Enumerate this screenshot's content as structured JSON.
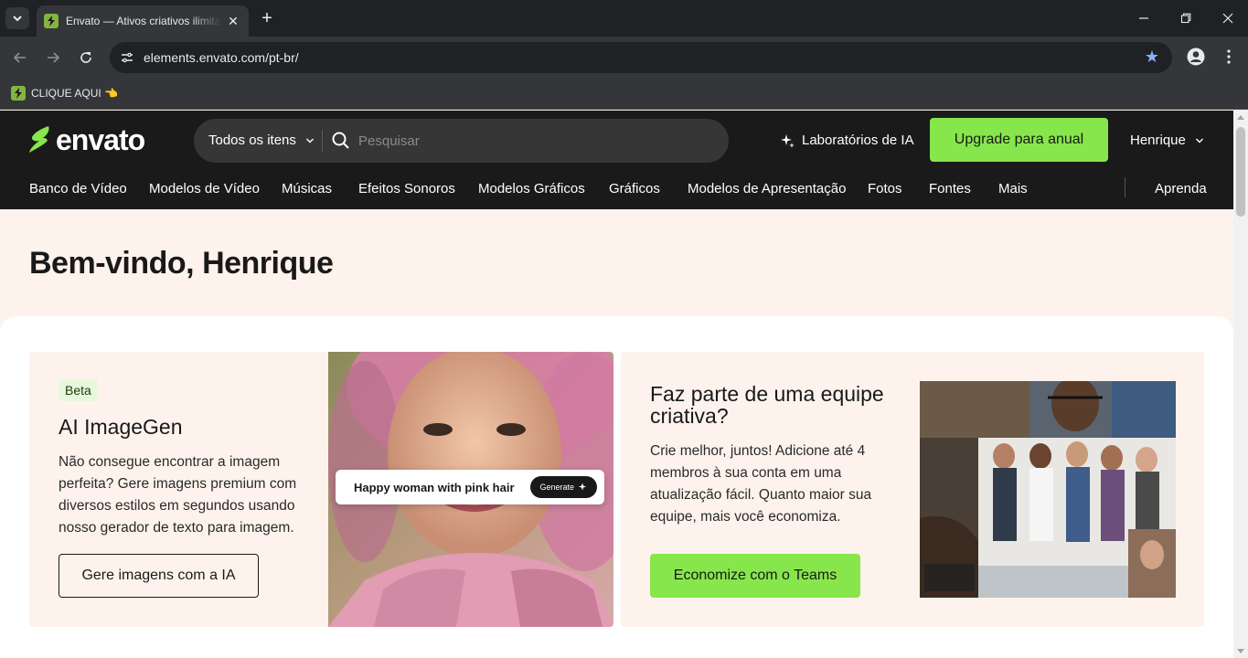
{
  "browser": {
    "tab_title": "Envato — Ativos criativos ilimitados",
    "tab_close": "✕",
    "new_tab": "+",
    "url": "elements.envato.com/pt-br/",
    "bookmark_label": "CLIQUE AQUI 👈"
  },
  "header": {
    "logo_text": "envato",
    "search_category": "Todos os itens",
    "search_placeholder": "Pesquisar",
    "ai_labs": "Laboratórios de IA",
    "upgrade": "Upgrade para anual",
    "user": "Henrique"
  },
  "categories": [
    "Banco de Vídeo",
    "Modelos de Vídeo",
    "Músicas",
    "Efeitos Sonoros",
    "Modelos Gráficos",
    "Gráficos",
    "Modelos de Apresentação",
    "Fotos",
    "Fontes",
    "Mais"
  ],
  "learn": "Aprenda",
  "welcome": "Bem-vindo, Henrique",
  "card_ai": {
    "badge": "Beta",
    "title": "AI ImageGen",
    "description": "Não consegue encontrar a imagem perfeita? Gere imagens premium com diversos estilos em segundos usando nosso gerador de texto para imagem.",
    "button": "Gere imagens com a IA",
    "prompt": "Happy woman with pink hair",
    "generate": "Generate"
  },
  "card_teams": {
    "title": "Faz parte de uma equipe criativa?",
    "description": "Crie melhor, juntos! Adicione até 4 membros à sua conta em uma atualização fácil. Quanto maior sua equipe, mais você economiza.",
    "button": "Economize com o Teams"
  },
  "colors": {
    "brand_green": "#87e64b",
    "header_bg": "#1a1a1a",
    "hero_bg": "#fdf3ec"
  }
}
